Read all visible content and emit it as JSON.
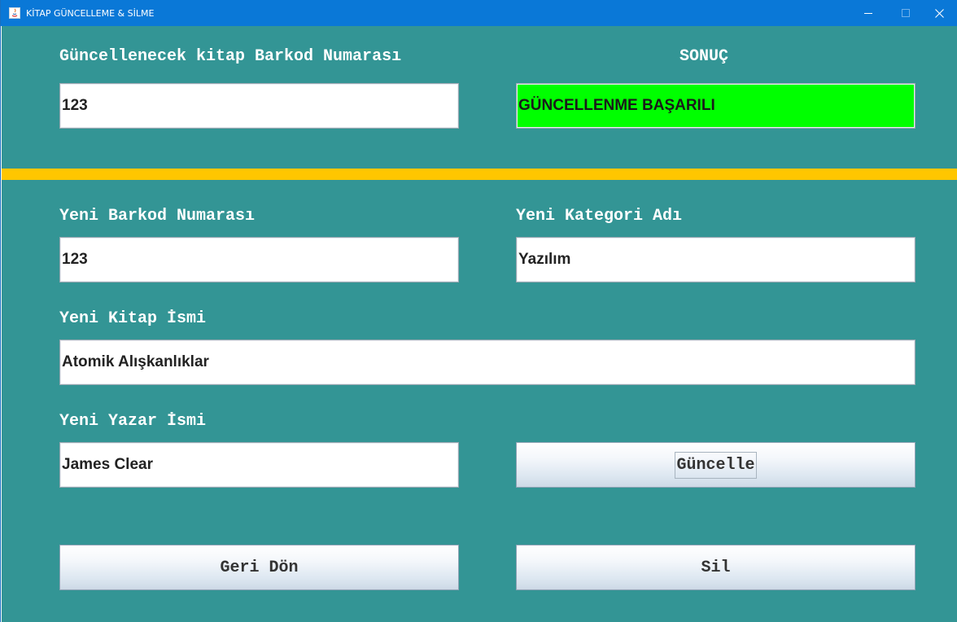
{
  "window": {
    "title": "KİTAP GÜNCELLEME & SİLME"
  },
  "form": {
    "search_label": "Güncellenecek kitap Barkod Numarası",
    "search_value": "123",
    "result_label": "SONUÇ",
    "result_value": "GÜNCELLENME BAŞARILI",
    "new_barcode_label": "Yeni Barkod Numarası",
    "new_barcode_value": "123",
    "new_category_label": "Yeni Kategori Adı",
    "new_category_value": "Yazılım",
    "new_book_name_label": "Yeni Kitap İsmi",
    "new_book_name_value": "Atomik Alışkanlıklar",
    "new_author_label": "Yeni Yazar İsmi",
    "new_author_value": "James Clear"
  },
  "buttons": {
    "update_label": "Güncelle",
    "back_label": "Geri Dön",
    "delete_label": "Sil"
  },
  "colors": {
    "background": "#339595",
    "titlebar": "#0a78d7",
    "divider": "#ffc600",
    "result_success": "#00ff00"
  }
}
